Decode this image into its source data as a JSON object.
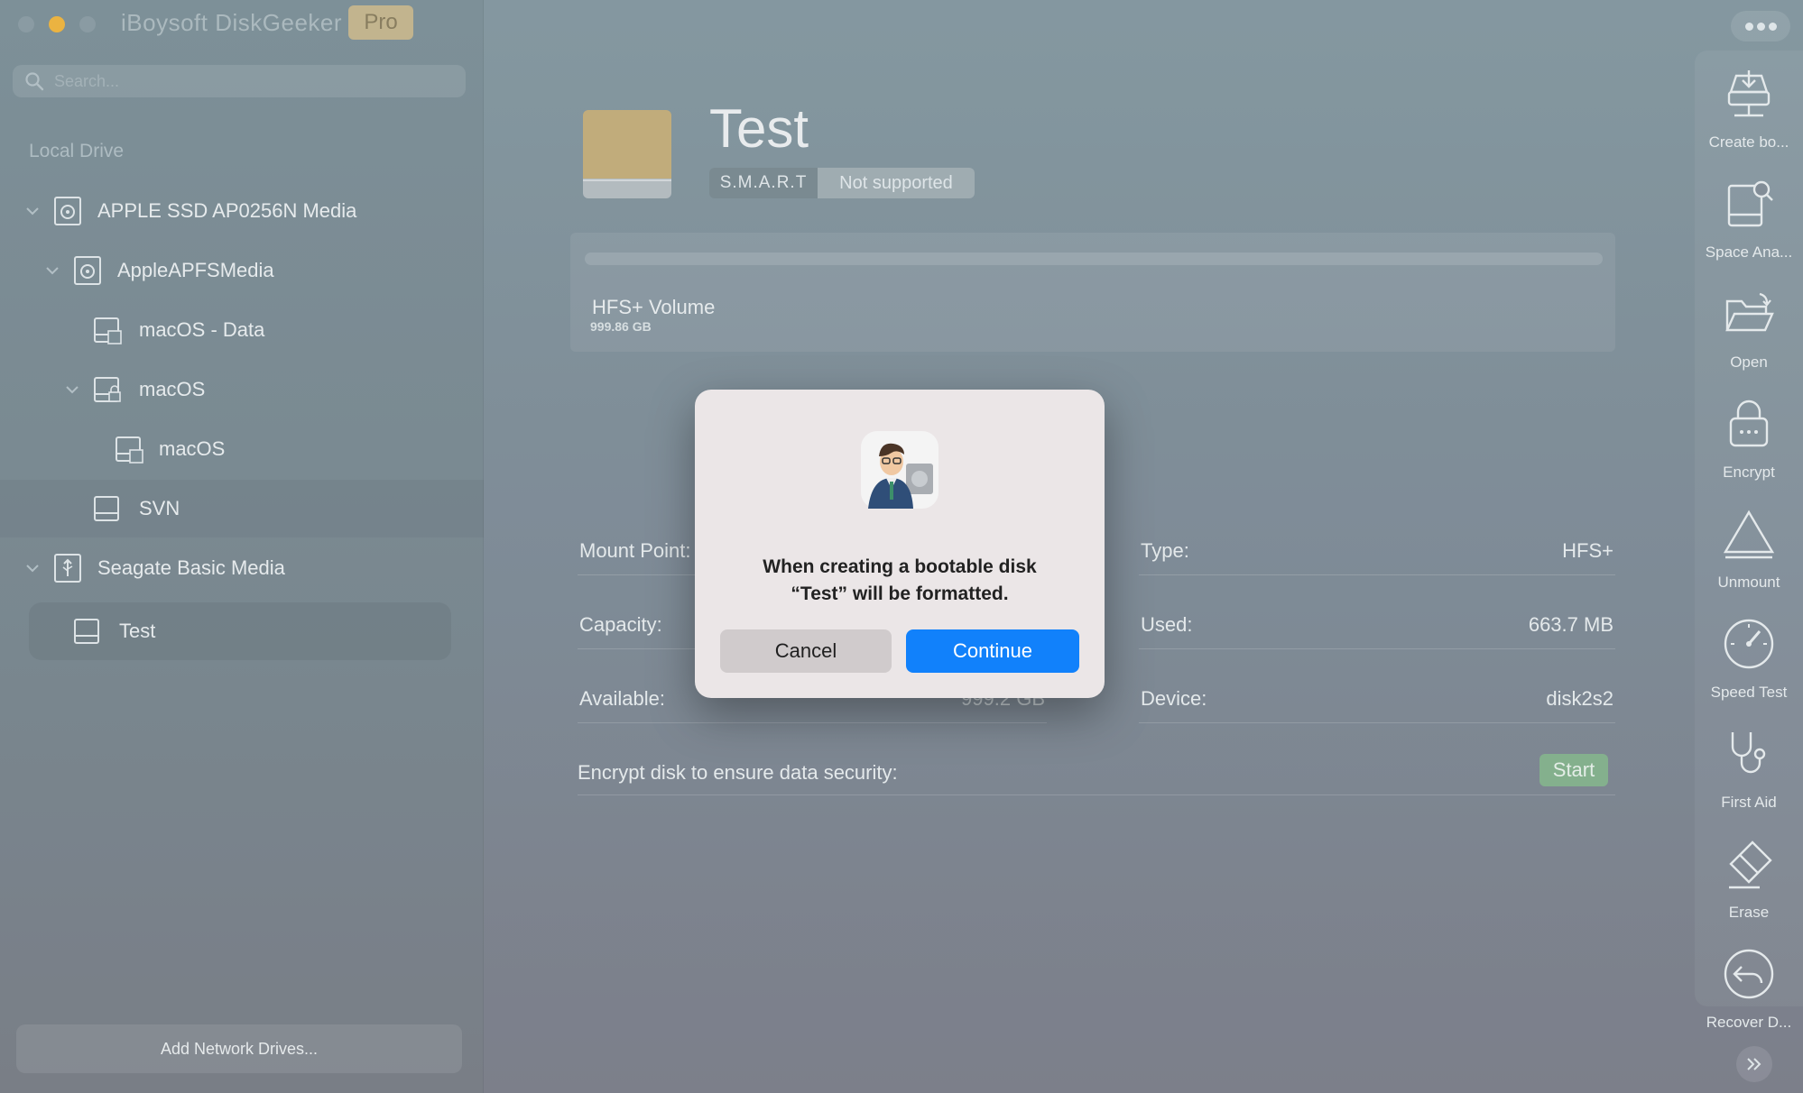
{
  "app": {
    "title": "iBoysoft DiskGeeker",
    "badge": "Pro"
  },
  "sidebar": {
    "search_placeholder": "Search...",
    "section_label": "Local Drive",
    "items": [
      {
        "label": "APPLE SSD AP0256N Media",
        "icon": "internal-disk-icon",
        "expanded": true
      },
      {
        "label": "AppleAPFSMedia",
        "icon": "internal-disk-icon",
        "expanded": true
      },
      {
        "label": "macOS - Data",
        "icon": "volume-icon"
      },
      {
        "label": "macOS",
        "icon": "locked-volume-icon",
        "expanded": true
      },
      {
        "label": "macOS",
        "icon": "volume-icon"
      },
      {
        "label": "SVN",
        "icon": "volume-icon"
      },
      {
        "label": "Seagate Basic Media",
        "icon": "usb-disk-icon",
        "expanded": true
      },
      {
        "label": "Test",
        "icon": "volume-icon",
        "selected": true
      }
    ],
    "add_network_label": "Add Network Drives..."
  },
  "main": {
    "drive_name": "Test",
    "smart_label": "S.M.A.R.T",
    "smart_value": "Not supported",
    "volume": {
      "name": "HFS+ Volume",
      "size": "999.86 GB",
      "used_fraction": 0.0
    },
    "info": {
      "mount_point_label": "Mount Point:",
      "type_label": "Type:",
      "type_value": "HFS+",
      "capacity_label": "Capacity:",
      "used_label": "Used:",
      "used_value": "663.7 MB",
      "available_label": "Available:",
      "available_value": "999.2 GB",
      "device_label": "Device:",
      "device_value": "disk2s2"
    },
    "encrypt_label": "Encrypt disk to ensure data security:",
    "start_label": "Start"
  },
  "toolbar": {
    "items": [
      {
        "label": "Create bo...",
        "icon": "create-boot-disk-icon"
      },
      {
        "label": "Space Ana...",
        "icon": "space-analyzer-icon"
      },
      {
        "label": "Open",
        "icon": "open-folder-icon"
      },
      {
        "label": "Encrypt",
        "icon": "lock-icon"
      },
      {
        "label": "Unmount",
        "icon": "eject-icon"
      },
      {
        "label": "Speed Test",
        "icon": "speedometer-icon"
      },
      {
        "label": "First Aid",
        "icon": "stethoscope-icon"
      },
      {
        "label": "Erase",
        "icon": "eraser-icon"
      },
      {
        "label": "Recover D...",
        "icon": "recover-data-icon"
      }
    ]
  },
  "dialog": {
    "message_line1": "When creating a bootable disk",
    "message_line2": "“Test” will be formatted.",
    "cancel_label": "Cancel",
    "continue_label": "Continue"
  },
  "colors": {
    "accent_blue": "#1181fb",
    "start_green": "#86b58e",
    "minimize_yellow": "#f6b83b",
    "pro_badge": "#c9b98f"
  }
}
